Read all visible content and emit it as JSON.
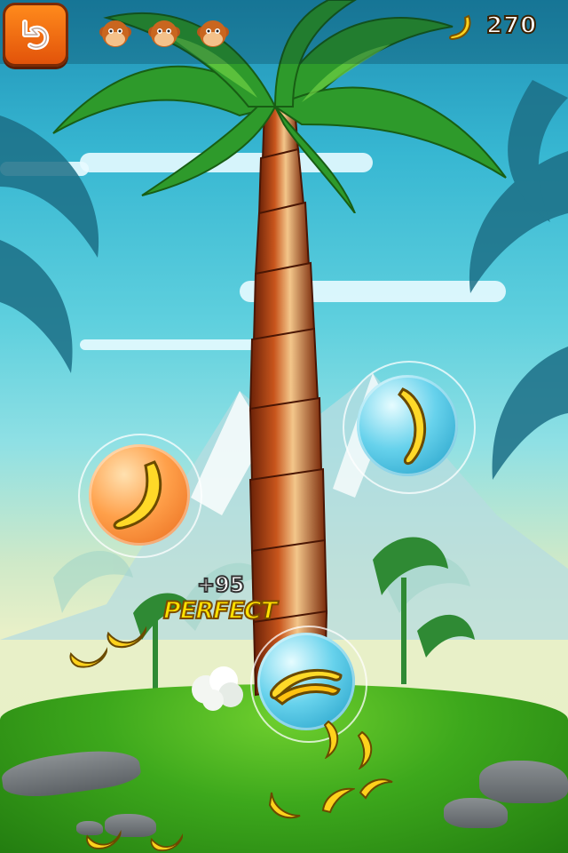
{
  "hud": {
    "back_icon": "undo-arrow-icon",
    "lives": [
      "monkey-face-icon",
      "monkey-face-icon",
      "monkey-face-icon"
    ],
    "banana_icon": "banana-icon",
    "score": "270"
  },
  "popup": {
    "points": "+95",
    "rating": "PERFECT"
  },
  "bubbles": [
    {
      "kind": "orange",
      "icon": "banana-icon"
    },
    {
      "kind": "blue",
      "icon": "banana-icon"
    },
    {
      "kind": "blue",
      "icon": "banana-bunch-icon"
    }
  ],
  "colors": {
    "accent": "#f07a14",
    "sky": "#37b7d2",
    "grass": "#3da81c",
    "trunk": "#9a3b12"
  }
}
